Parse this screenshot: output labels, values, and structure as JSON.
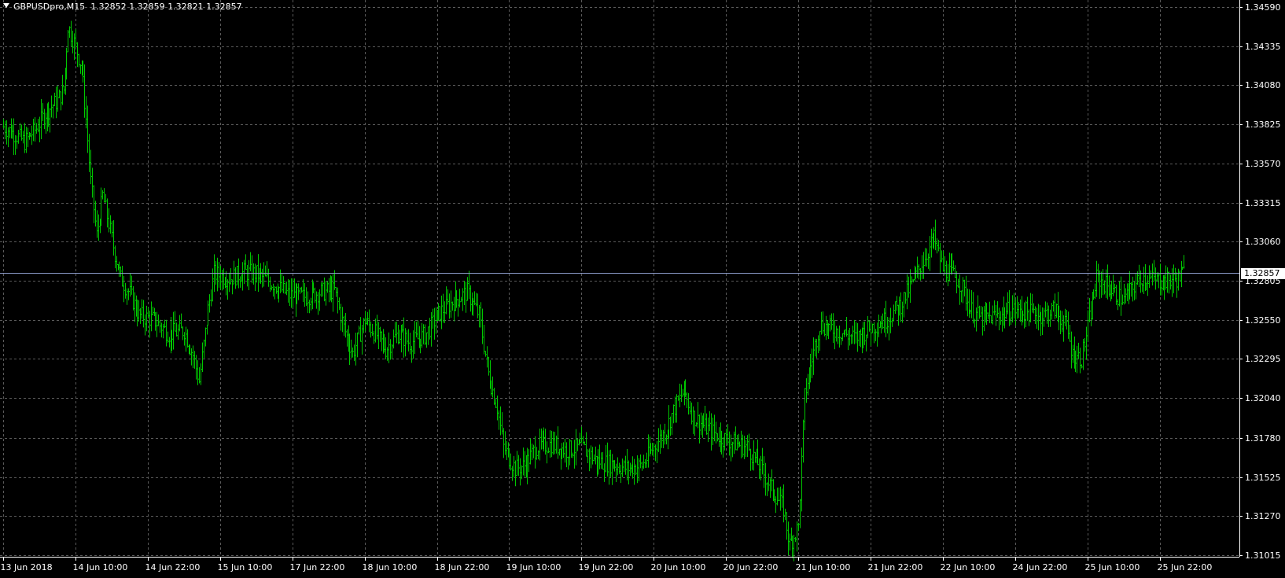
{
  "header": {
    "symbol_label": "GBPUSDpro,M15",
    "open": "1.32852",
    "high": "1.32859",
    "low": "1.32821",
    "close": "1.32857"
  },
  "colors": {
    "background": "#000000",
    "bars": "#00c800",
    "grid": "#5a5a5a",
    "price_line": "#8a9ac8",
    "text": "#ffffff"
  },
  "current_price": {
    "value": 1.32857,
    "label": "1.32857"
  },
  "chart_data": {
    "type": "line",
    "title": "GBPUSDpro,M15",
    "xlabel": "",
    "ylabel": "",
    "ylim": [
      1.3088,
      1.3459
    ],
    "grid": true,
    "y_ticks": [
      {
        "value": 1.3459,
        "label": "1.34590"
      },
      {
        "value": 1.34335,
        "label": "1.34335"
      },
      {
        "value": 1.3408,
        "label": "1.34080"
      },
      {
        "value": 1.33825,
        "label": "1.33825"
      },
      {
        "value": 1.3357,
        "label": "1.33570"
      },
      {
        "value": 1.33315,
        "label": "1.33315"
      },
      {
        "value": 1.3306,
        "label": "1.33060"
      },
      {
        "value": 1.32805,
        "label": "1.32805"
      },
      {
        "value": 1.3255,
        "label": "1.32550"
      },
      {
        "value": 1.32295,
        "label": "1.32295"
      },
      {
        "value": 1.3204,
        "label": "1.32040"
      },
      {
        "value": 1.3178,
        "label": "1.31780"
      },
      {
        "value": 1.31525,
        "label": "1.31525"
      },
      {
        "value": 1.3127,
        "label": "1.31270"
      },
      {
        "value": 1.31015,
        "label": "1.31015"
      }
    ],
    "x_ticks": [
      {
        "index": 0,
        "label": "13 Jun 2018"
      },
      {
        "index": 48,
        "label": "14 Jun 10:00"
      },
      {
        "index": 96,
        "label": "14 Jun 22:00"
      },
      {
        "index": 144,
        "label": "15 Jun 10:00"
      },
      {
        "index": 192,
        "label": "17 Jun 22:00"
      },
      {
        "index": 240,
        "label": "18 Jun 10:00"
      },
      {
        "index": 288,
        "label": "18 Jun 22:00"
      },
      {
        "index": 336,
        "label": "19 Jun 10:00"
      },
      {
        "index": 384,
        "label": "19 Jun 22:00"
      },
      {
        "index": 432,
        "label": "20 Jun 10:00"
      },
      {
        "index": 480,
        "label": "20 Jun 22:00"
      },
      {
        "index": 528,
        "label": "21 Jun 10:00"
      },
      {
        "index": 576,
        "label": "21 Jun 22:00"
      },
      {
        "index": 624,
        "label": "22 Jun 10:00"
      },
      {
        "index": 672,
        "label": "24 Jun 22:00"
      },
      {
        "index": 720,
        "label": "25 Jun 10:00"
      },
      {
        "index": 768,
        "label": "25 Jun 22:00"
      }
    ],
    "bar_count": 785,
    "series": [
      {
        "path_points": [
          [
            0,
            1.3381
          ],
          [
            8,
            1.3376
          ],
          [
            14,
            1.3371
          ],
          [
            22,
            1.338
          ],
          [
            28,
            1.339
          ],
          [
            36,
            1.3398
          ],
          [
            40,
            1.3405
          ],
          [
            43,
            1.3447
          ],
          [
            47,
            1.3436
          ],
          [
            52,
            1.342
          ],
          [
            55,
            1.3386
          ],
          [
            58,
            1.3345
          ],
          [
            62,
            1.331
          ],
          [
            66,
            1.3336
          ],
          [
            70,
            1.3318
          ],
          [
            74,
            1.3298
          ],
          [
            78,
            1.3282
          ],
          [
            84,
            1.3272
          ],
          [
            90,
            1.3258
          ],
          [
            100,
            1.3255
          ],
          [
            110,
            1.3246
          ],
          [
            120,
            1.3248
          ],
          [
            126,
            1.3232
          ],
          [
            130,
            1.3215
          ],
          [
            136,
            1.3262
          ],
          [
            140,
            1.3285
          ],
          [
            150,
            1.3282
          ],
          [
            160,
            1.3286
          ],
          [
            168,
            1.3285
          ],
          [
            180,
            1.3278
          ],
          [
            190,
            1.3271
          ],
          [
            200,
            1.327
          ],
          [
            210,
            1.3273
          ],
          [
            220,
            1.3274
          ],
          [
            226,
            1.325
          ],
          [
            232,
            1.3233
          ],
          [
            240,
            1.3255
          ],
          [
            248,
            1.3245
          ],
          [
            254,
            1.3236
          ],
          [
            262,
            1.3246
          ],
          [
            270,
            1.324
          ],
          [
            280,
            1.3245
          ],
          [
            290,
            1.326
          ],
          [
            300,
            1.3268
          ],
          [
            308,
            1.3273
          ],
          [
            316,
            1.3258
          ],
          [
            322,
            1.322
          ],
          [
            328,
            1.3198
          ],
          [
            332,
            1.3172
          ],
          [
            340,
            1.3158
          ],
          [
            346,
            1.316
          ],
          [
            354,
            1.3172
          ],
          [
            364,
            1.3174
          ],
          [
            374,
            1.317
          ],
          [
            384,
            1.3172
          ],
          [
            394,
            1.3163
          ],
          [
            404,
            1.3161
          ],
          [
            414,
            1.3158
          ],
          [
            424,
            1.316
          ],
          [
            432,
            1.3172
          ],
          [
            440,
            1.3183
          ],
          [
            446,
            1.3198
          ],
          [
            452,
            1.3209
          ],
          [
            458,
            1.3192
          ],
          [
            466,
            1.3185
          ],
          [
            474,
            1.318
          ],
          [
            484,
            1.3175
          ],
          [
            494,
            1.3172
          ],
          [
            502,
            1.316
          ],
          [
            510,
            1.3145
          ],
          [
            518,
            1.3132
          ],
          [
            522,
            1.3108
          ],
          [
            528,
            1.312
          ],
          [
            532,
            1.3205
          ],
          [
            536,
            1.3225
          ],
          [
            542,
            1.3252
          ],
          [
            548,
            1.325
          ],
          [
            556,
            1.3247
          ],
          [
            566,
            1.3243
          ],
          [
            576,
            1.325
          ],
          [
            586,
            1.3255
          ],
          [
            596,
            1.3265
          ],
          [
            604,
            1.328
          ],
          [
            612,
            1.3296
          ],
          [
            618,
            1.3308
          ],
          [
            624,
            1.3288
          ],
          [
            630,
            1.3285
          ],
          [
            636,
            1.3278
          ],
          [
            642,
            1.3262
          ],
          [
            650,
            1.3255
          ],
          [
            660,
            1.3258
          ],
          [
            670,
            1.3262
          ],
          [
            680,
            1.326
          ],
          [
            690,
            1.3258
          ],
          [
            698,
            1.3262
          ],
          [
            706,
            1.325
          ],
          [
            710,
            1.3232
          ],
          [
            716,
            1.323
          ],
          [
            722,
            1.326
          ],
          [
            726,
            1.3282
          ],
          [
            732,
            1.3278
          ],
          [
            738,
            1.3272
          ],
          [
            744,
            1.3268
          ],
          [
            750,
            1.3276
          ],
          [
            756,
            1.3283
          ],
          [
            764,
            1.3281
          ],
          [
            772,
            1.328
          ],
          [
            780,
            1.3282
          ],
          [
            784,
            1.3286
          ]
        ]
      }
    ]
  }
}
